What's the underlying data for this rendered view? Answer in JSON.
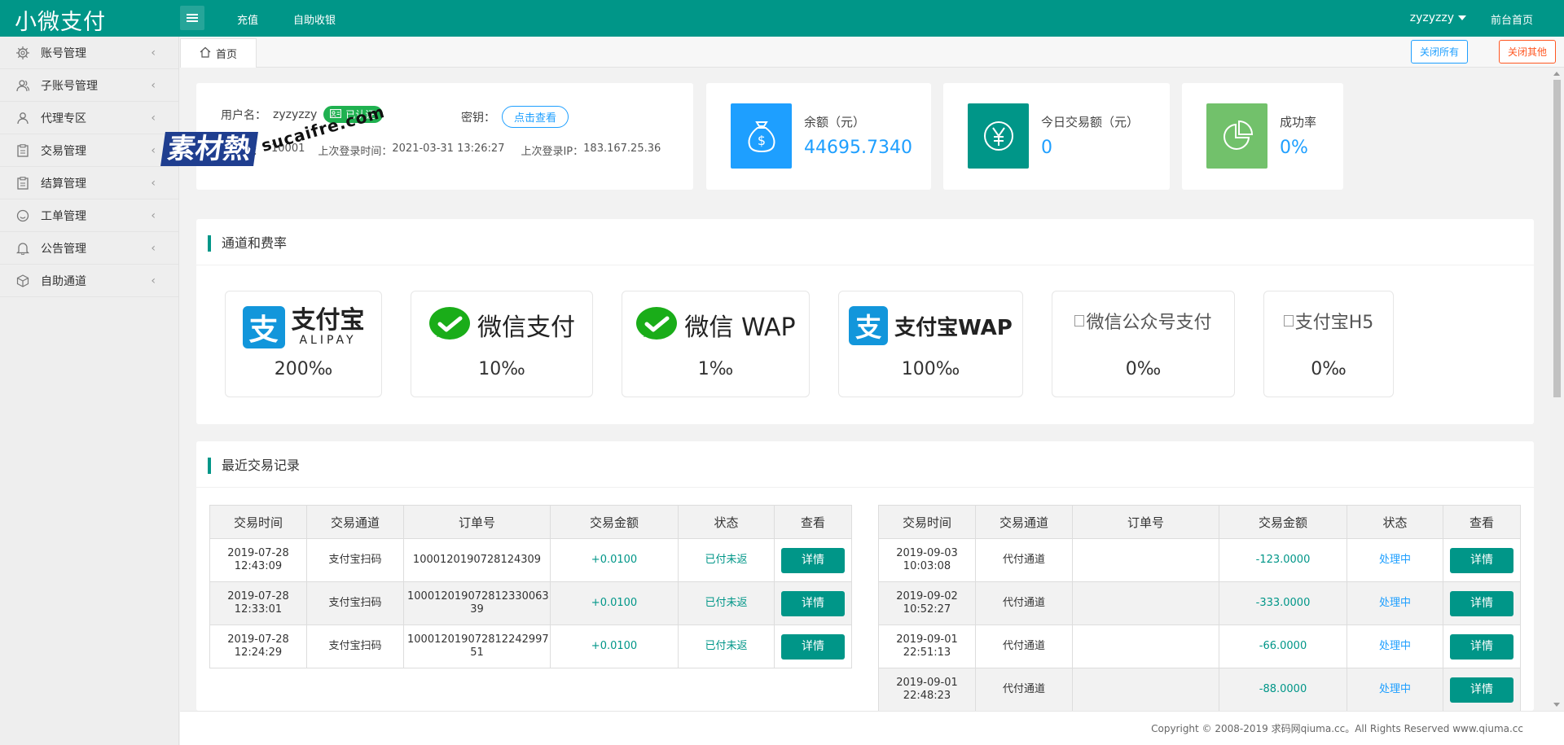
{
  "app": {
    "logo": "小微支付",
    "nav": [
      "充值",
      "自助收银"
    ],
    "user": "zyzyzzy",
    "front_link": "前台首页"
  },
  "sidebar": {
    "items": [
      {
        "label": "账号管理",
        "icon": "gear-icon"
      },
      {
        "label": "子账号管理",
        "icon": "users-icon"
      },
      {
        "label": "代理专区",
        "icon": "user-icon"
      },
      {
        "label": "交易管理",
        "icon": "clipboard-icon"
      },
      {
        "label": "结算管理",
        "icon": "clipboard-icon"
      },
      {
        "label": "工单管理",
        "icon": "smile-icon"
      },
      {
        "label": "公告管理",
        "icon": "bell-icon"
      },
      {
        "label": "自助通道",
        "icon": "cube-icon"
      }
    ]
  },
  "tabs": {
    "home": "首页",
    "close_all": "关闭所有",
    "close_other": "关闭其他"
  },
  "user_card": {
    "username_label": "用户名：",
    "username": "zyzyzzy",
    "verified": "已认证",
    "key_label": "密钥：",
    "view_key": "点击查看",
    "merchant_label": "商户号：",
    "merchant_no": "10001",
    "last_login_time_label": "上次登录时间：",
    "last_login_time": "2021-03-31 13:26:27",
    "last_login_ip_label": "上次登录IP：",
    "last_login_ip": "183.167.25.36"
  },
  "stats": [
    {
      "label": "余额（元）",
      "value": "44695.7340",
      "icon": "money-bag-icon",
      "color": "#1e9fff"
    },
    {
      "label": "今日交易额（元）",
      "value": "0",
      "icon": "yen-icon",
      "color": "#009688"
    },
    {
      "label": "成功率",
      "value": "0%",
      "icon": "pie-chart-icon",
      "color": "#72c16b"
    }
  ],
  "channels_section": {
    "title": "通道和费率",
    "channels": [
      {
        "name": "支付宝",
        "sub": "ALIPAY",
        "rate": "200‰",
        "icon": "alipay-icon"
      },
      {
        "name": "微信支付",
        "rate": "10‰",
        "icon": "wechat-icon"
      },
      {
        "name": "微信 WAP",
        "rate": "1‰",
        "icon": "wechat-icon"
      },
      {
        "name": "支付宝WAP",
        "rate": "100‰",
        "icon": "alipay-icon"
      },
      {
        "name": "微信公众号支付",
        "rate": "0‰",
        "icon": "broken-image-icon"
      },
      {
        "name": "支付宝H5",
        "rate": "0‰",
        "icon": "broken-image-icon"
      }
    ]
  },
  "records_section": {
    "title": "最近交易记录",
    "headers": [
      "交易时间",
      "交易通道",
      "订单号",
      "交易金额",
      "状态",
      "查看"
    ],
    "detail_label": "详情",
    "left_rows": [
      {
        "time": "2019-07-28 12:43:09",
        "channel": "支付宝扫码",
        "order": "1000120190728124309",
        "amount": "+0.0100",
        "status": "已付未返"
      },
      {
        "time": "2019-07-28 12:33:01",
        "channel": "支付宝扫码",
        "order": "100012019072812330063 39",
        "amount": "+0.0100",
        "status": "已付未返"
      },
      {
        "time": "2019-07-28 12:24:29",
        "channel": "支付宝扫码",
        "order": "100012019072812242997 51",
        "amount": "+0.0100",
        "status": "已付未返"
      }
    ],
    "right_rows": [
      {
        "time": "2019-09-03 10:03:08",
        "channel": "代付通道",
        "order": "",
        "amount": "-123.0000",
        "status": "处理中"
      },
      {
        "time": "2019-09-02 10:52:27",
        "channel": "代付通道",
        "order": "",
        "amount": "-333.0000",
        "status": "处理中"
      },
      {
        "time": "2019-09-01 22:51:13",
        "channel": "代付通道",
        "order": "",
        "amount": "-66.0000",
        "status": "处理中"
      },
      {
        "time": "2019-09-01 22:48:23",
        "channel": "代付通道",
        "order": "",
        "amount": "-88.0000",
        "status": "处理中"
      }
    ]
  },
  "footer": "Copyright © 2008-2019 求码网qiuma.cc。All Rights Reserved www.qiuma.cc",
  "watermark": {
    "text": "素材熱",
    "url": "sucaifre.com"
  }
}
